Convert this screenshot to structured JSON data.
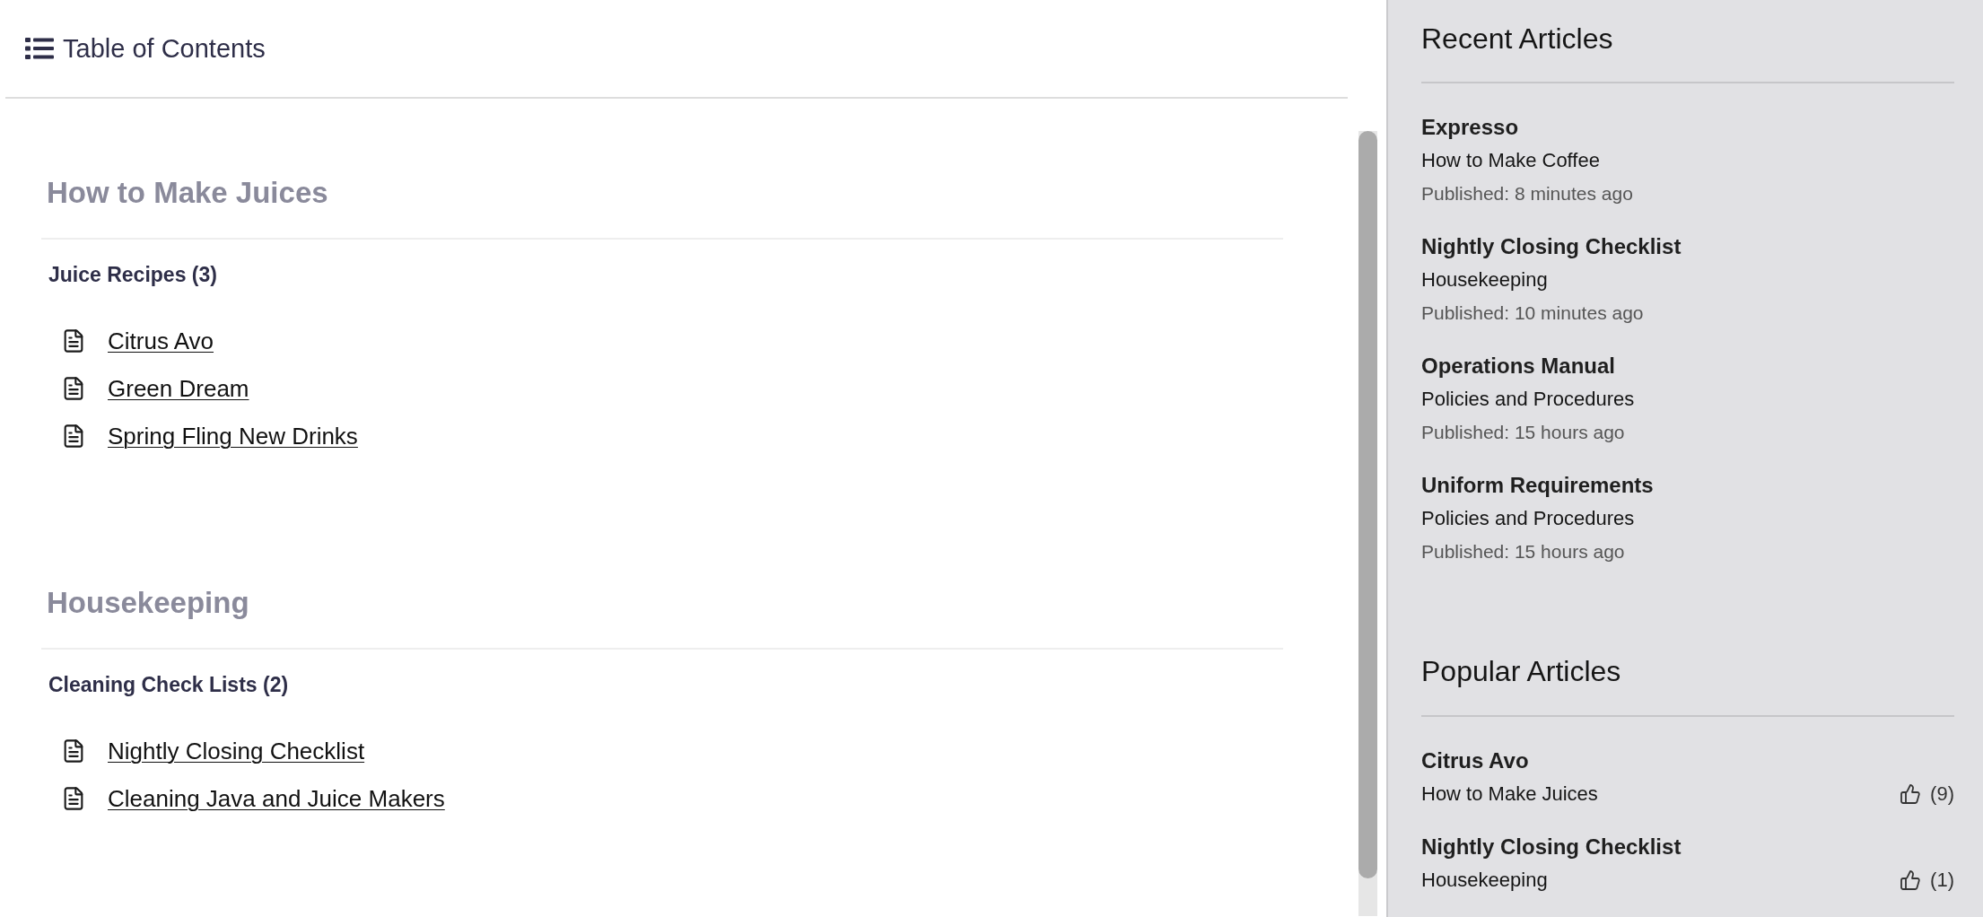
{
  "toc": {
    "title": "Table of Contents"
  },
  "categories": [
    {
      "title": "How to Make Juices",
      "groups": [
        {
          "title": "Juice Recipes (3)",
          "articles": [
            "Citrus Avo",
            "Green Dream",
            "Spring Fling New Drinks"
          ]
        }
      ]
    },
    {
      "title": "Housekeeping",
      "groups": [
        {
          "title": "Cleaning Check Lists (2)",
          "articles": [
            "Nightly Closing Checklist",
            "Cleaning Java and Juice Makers"
          ]
        }
      ]
    }
  ],
  "recent_articles": {
    "title": "Recent Articles",
    "items": [
      {
        "title": "Expresso",
        "category": "How to Make Coffee",
        "published": "Published: 8 minutes ago"
      },
      {
        "title": "Nightly Closing Checklist",
        "category": "Housekeeping",
        "published": "Published: 10 minutes ago"
      },
      {
        "title": "Operations Manual",
        "category": "Policies and Procedures",
        "published": "Published: 15 hours ago"
      },
      {
        "title": "Uniform Requirements",
        "category": "Policies and Procedures",
        "published": "Published: 15 hours ago"
      }
    ]
  },
  "popular_articles": {
    "title": "Popular Articles",
    "items": [
      {
        "title": "Citrus Avo",
        "category": "How to Make Juices",
        "likes": "(9)"
      },
      {
        "title": "Nightly Closing Checklist",
        "category": "Housekeeping",
        "likes": "(1)"
      }
    ]
  }
}
